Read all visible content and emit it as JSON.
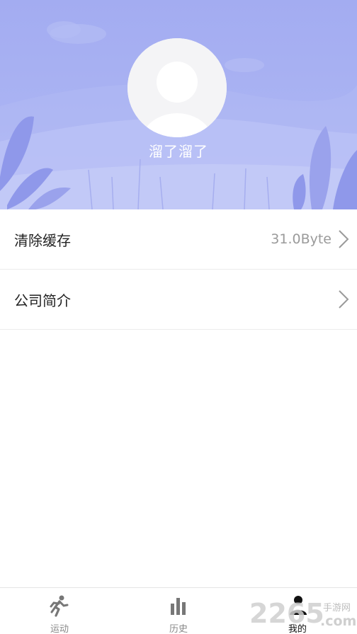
{
  "profile": {
    "username": "溜了溜了"
  },
  "menu": {
    "items": [
      {
        "label": "清除缓存",
        "value": "31.0Byte"
      },
      {
        "label": "公司简介",
        "value": ""
      }
    ]
  },
  "tabbar": {
    "tabs": [
      {
        "label": "运动",
        "icon": "running-icon",
        "active": false
      },
      {
        "label": "历史",
        "icon": "bar-chart-icon",
        "active": false
      },
      {
        "label": "我的",
        "icon": "person-icon",
        "active": true
      }
    ]
  },
  "watermark": {
    "brand": "2265",
    "suffix_cn": "手游网",
    "suffix_en": ".com"
  },
  "colors": {
    "header_bg": "#a3acf1",
    "leaf": "#8f98ea",
    "text_primary": "#222222",
    "text_secondary": "#9a9a9a"
  }
}
